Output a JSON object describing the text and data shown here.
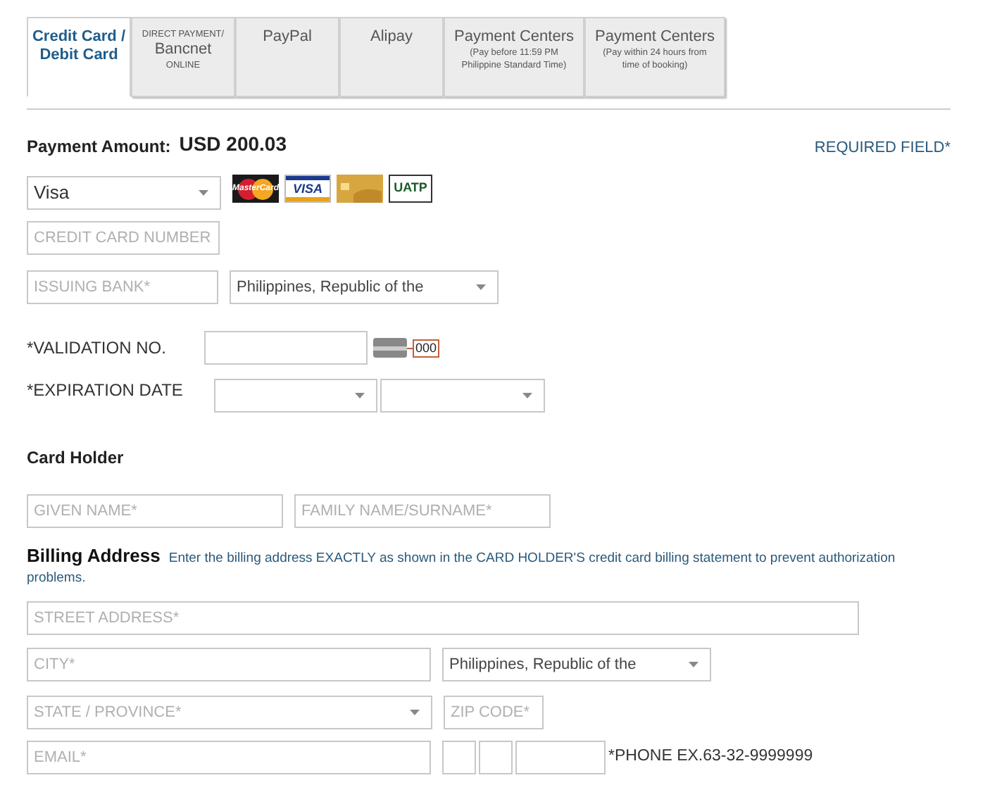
{
  "tabs": [
    {
      "selected": true,
      "lines": [
        {
          "kind": "title",
          "text": "Credit Card /"
        },
        {
          "kind": "title",
          "text": "Debit Card"
        }
      ]
    },
    {
      "selected": false,
      "lines": [
        {
          "kind": "note",
          "text": "DIRECT PAYMENT/"
        },
        {
          "kind": "title",
          "text": "Bancnet"
        },
        {
          "kind": "note",
          "text": "ONLINE"
        }
      ]
    },
    {
      "selected": false,
      "lines": [
        {
          "kind": "title",
          "text": "PayPal"
        }
      ]
    },
    {
      "selected": false,
      "lines": [
        {
          "kind": "title",
          "text": "Alipay"
        }
      ]
    },
    {
      "selected": false,
      "lines": [
        {
          "kind": "title",
          "text": "Payment Centers"
        },
        {
          "kind": "note",
          "text": "(Pay before 11:59 PM"
        },
        {
          "kind": "note",
          "text": "Philippine Standard Time)"
        }
      ]
    },
    {
      "selected": false,
      "lines": [
        {
          "kind": "title",
          "text": "Payment Centers"
        },
        {
          "kind": "note",
          "text": "(Pay within 24 hours from"
        },
        {
          "kind": "note",
          "text": "time of booking)"
        }
      ]
    }
  ],
  "payment": {
    "label": "Payment Amount:",
    "amount": "USD 200.03",
    "required_note": "REQUIRED FIELD*"
  },
  "card_type": {
    "value": "Visa"
  },
  "card_logos": [
    {
      "kind": "mastercard",
      "label": "MasterCard"
    },
    {
      "kind": "visa",
      "label": "VISA"
    },
    {
      "kind": "gold"
    },
    {
      "kind": "uatp",
      "label": "UATP"
    }
  ],
  "card_number": {
    "placeholder": "CREDIT CARD NUMBER"
  },
  "issuing_bank": {
    "placeholder": "ISSUING BANK*"
  },
  "bank_country": {
    "value": "Philippines, Republic of the"
  },
  "validation": {
    "label": "*VALIDATION NO.",
    "hint_code": "000"
  },
  "expiration": {
    "label": "*EXPIRATION DATE"
  },
  "card_holder": {
    "heading": "Card Holder",
    "given_name": {
      "placeholder": "GIVEN NAME*"
    },
    "family_name": {
      "placeholder": "FAMILY NAME/SURNAME*"
    }
  },
  "billing": {
    "heading": "Billing Address",
    "note": "Enter the billing address EXACTLY as shown in the CARD HOLDER'S credit card billing statement to prevent authorization problems.",
    "street": {
      "placeholder": "STREET ADDRESS*"
    },
    "city": {
      "placeholder": "CITY*"
    },
    "country": {
      "value": "Philippines, Republic of the"
    },
    "state": {
      "placeholder": "STATE / PROVINCE*"
    },
    "zip": {
      "placeholder": "ZIP CODE*"
    },
    "email": {
      "placeholder": "EMAIL*"
    },
    "phone_label": "*PHONE EX.63-32-9999999"
  }
}
